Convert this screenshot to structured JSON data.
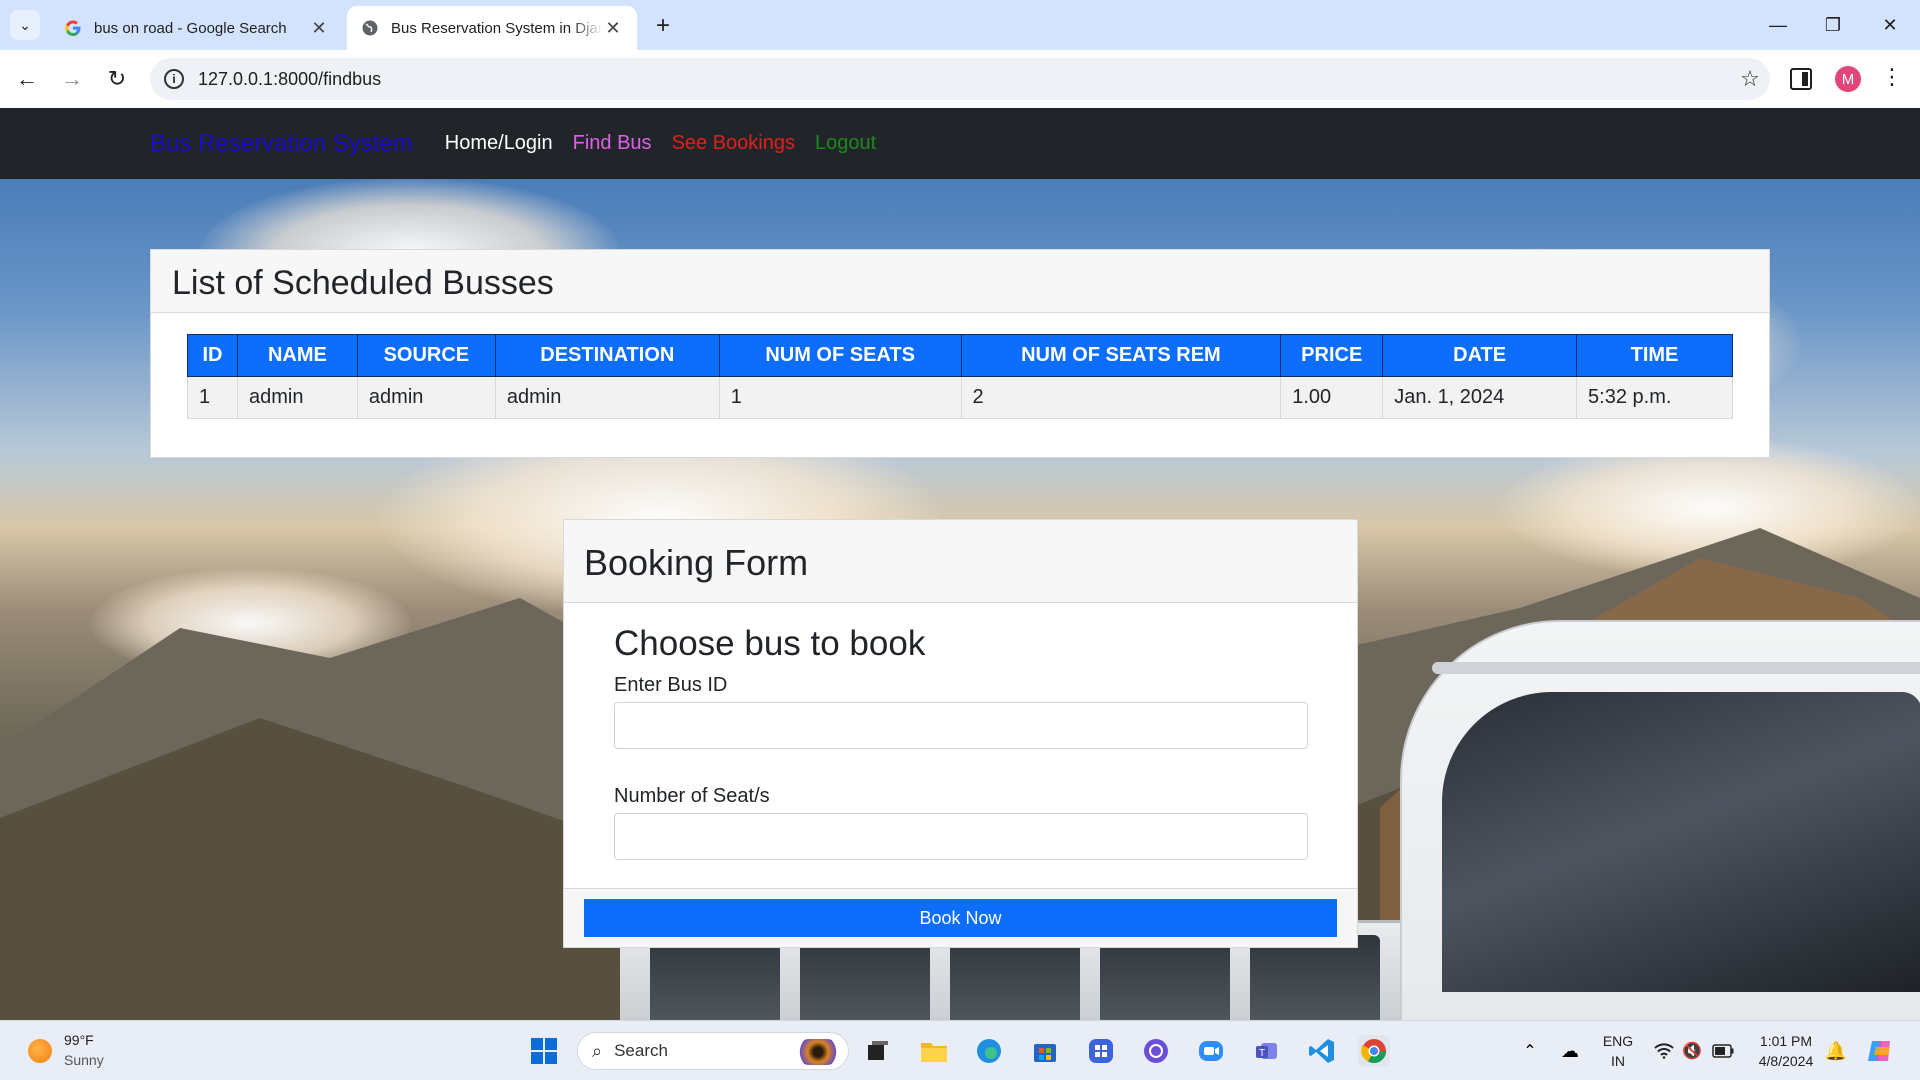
{
  "browser": {
    "tabs": [
      {
        "title": "bus on road - Google Search",
        "active": false,
        "favicon": "google-icon"
      },
      {
        "title": "Bus Reservation System in Django",
        "active": true,
        "favicon": "globe-icon"
      }
    ],
    "url": "127.0.0.1:8000/findbus",
    "profile_initial": "M"
  },
  "navbar": {
    "brand": "Bus Reservation System",
    "links": [
      {
        "label": "Home/Login",
        "color": "#ffffff"
      },
      {
        "label": "Find Bus",
        "color": "#e060e8"
      },
      {
        "label": "See Bookings",
        "color": "#e0201a"
      },
      {
        "label": "Logout",
        "color": "#1c8a1c"
      }
    ]
  },
  "bus_list": {
    "title": "List of Scheduled Busses",
    "columns": [
      "ID",
      "NAME",
      "SOURCE",
      "DESTINATION",
      "NUM OF SEATS",
      "NUM OF SEATS REM",
      "PRICE",
      "DATE",
      "TIME"
    ],
    "rows": [
      [
        "1",
        "admin",
        "admin",
        "admin",
        "1",
        "2",
        "1.00",
        "Jan. 1, 2024",
        "5:32 p.m."
      ]
    ]
  },
  "booking_form": {
    "title": "Booking Form",
    "subtitle": "Choose bus to book",
    "bus_id_label": "Enter Bus ID",
    "bus_id_value": "",
    "seats_label": "Number of Seat/s",
    "seats_value": "",
    "submit_label": "Book Now"
  },
  "taskbar": {
    "weather_temp": "99°F",
    "weather_desc": "Sunny",
    "search_placeholder": "Search",
    "language": "ENG",
    "region": "IN",
    "time": "1:01 PM",
    "date": "4/8/2024"
  }
}
